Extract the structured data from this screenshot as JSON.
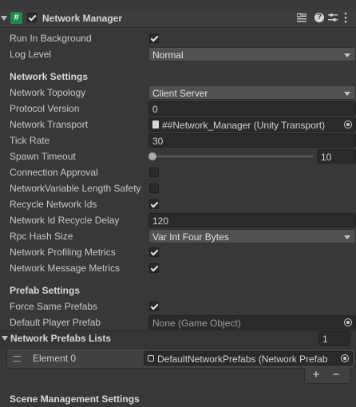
{
  "header": {
    "title": "Network Manager",
    "script_icon": "#",
    "component_enabled": true,
    "icons": [
      "settings-preset-icon",
      "help-icon",
      "slider-settings-icon",
      "more-options-icon"
    ]
  },
  "fields": {
    "run_in_background": {
      "label": "Run In Background",
      "checked": true
    },
    "log_level": {
      "label": "Log Level",
      "value": "Normal"
    },
    "network_settings_header": "Network Settings",
    "network_topology": {
      "label": "Network Topology",
      "value": "Client Server"
    },
    "protocol_version": {
      "label": "Protocol Version",
      "value": "0"
    },
    "network_transport": {
      "label": "Network Transport",
      "value": "##Network_Manager (Unity Transport)"
    },
    "tick_rate": {
      "label": "Tick Rate",
      "value": "30"
    },
    "spawn_timeout": {
      "label": "Spawn Timeout",
      "value": "10",
      "slider_fraction": 0.0
    },
    "connection_approval": {
      "label": "Connection Approval",
      "checked": false
    },
    "networkvariable_length_safety": {
      "label": "NetworkVariable Length Safety",
      "checked": false
    },
    "recycle_network_ids": {
      "label": "Recycle Network Ids",
      "checked": true
    },
    "network_id_recycle_delay": {
      "label": "Network Id Recycle Delay",
      "value": "120"
    },
    "rpc_hash_size": {
      "label": "Rpc Hash Size",
      "value": "Var Int Four Bytes"
    },
    "network_profiling_metrics": {
      "label": "Network Profiling Metrics",
      "checked": true
    },
    "network_message_metrics": {
      "label": "Network Message Metrics",
      "checked": true
    },
    "prefab_settings_header": "Prefab Settings",
    "force_same_prefabs": {
      "label": "Force Same Prefabs",
      "checked": true
    },
    "default_player_prefab": {
      "label": "Default Player Prefab",
      "value": "None (Game Object)"
    }
  },
  "prefab_lists": {
    "label": "Network Prefabs Lists",
    "count": "1",
    "elements": [
      {
        "label": "Element 0",
        "value": "DefaultNetworkPrefabs (Network Prefab"
      }
    ],
    "add_label": "+",
    "remove_label": "−"
  },
  "footer": {
    "label": "Scene Management Settings"
  },
  "colors": {
    "background": "#383838",
    "header_bg": "#3e3e3e",
    "field_bg": "#2a2a2a",
    "dropdown_bg": "#515151"
  }
}
